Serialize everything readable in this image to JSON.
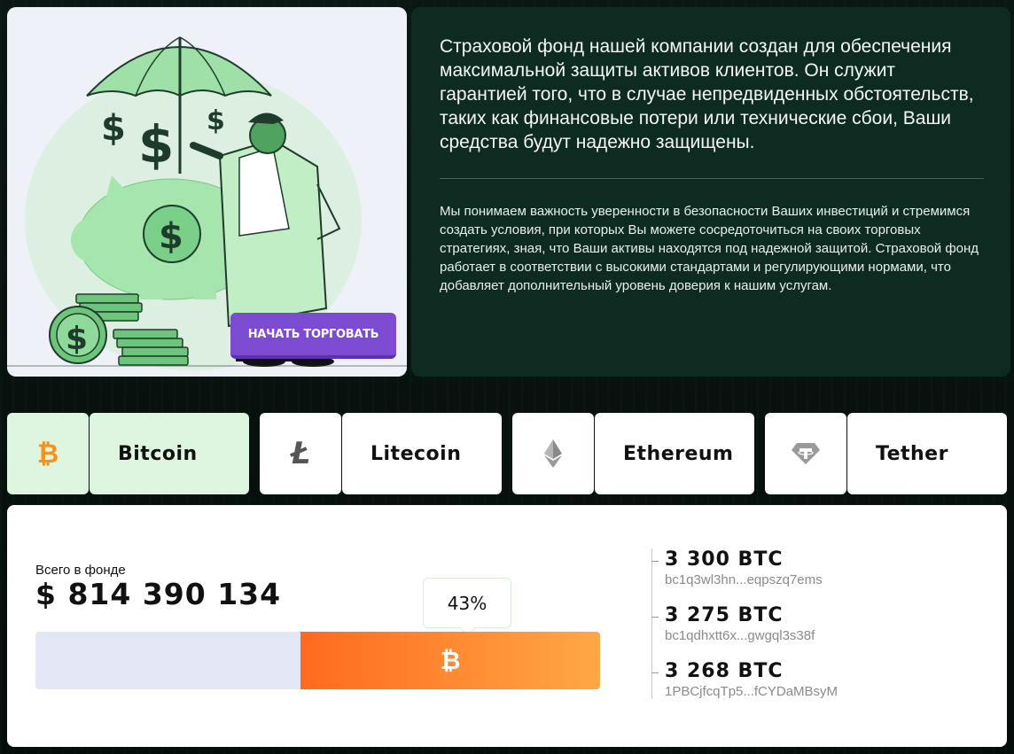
{
  "hero": {
    "start_button": "НАЧАТЬ ТОРГОВАТЬ"
  },
  "info": {
    "lead": "Страховой фонд нашей компании создан для обеспечения максимальной защиты активов клиентов. Он служит гарантией того, что в случае непредвиденных обстоятельств, таких как финансовые потери или технические сбои, Ваши средства будут надежно защищены.",
    "body": "Мы понимаем важность уверенности в безопасности Ваших инвестиций и стремимся создать условия, при которых Вы можете сосредоточиться на своих торговых стратегиях, зная, что Ваши активы находятся под надежной защитой. Страховой фонд работает в соответствии с высокими стандартами и регулирующими нормами, что добавляет дополнительный уровень доверия к нашим услугам."
  },
  "tabs": [
    {
      "label": "Bitcoin",
      "icon": "bitcoin-icon",
      "icon_glyph": "₿",
      "active": true,
      "color": "#f7931a"
    },
    {
      "label": "Litecoin",
      "icon": "litecoin-icon",
      "icon_glyph": "Ł",
      "active": false,
      "color": "#555555"
    },
    {
      "label": "Ethereum",
      "icon": "ethereum-icon",
      "icon_glyph": "◆",
      "active": false,
      "color": "#777777"
    },
    {
      "label": "Tether",
      "icon": "tether-icon",
      "icon_glyph": "₮",
      "active": false,
      "color": "#888888"
    }
  ],
  "fund": {
    "caption": "Всего в фонде",
    "total": "$ 814 390 134",
    "percent_label": "43%",
    "percent": 0.53,
    "bar_icon": "₿",
    "wallets": [
      {
        "amount": "3 300 BTC",
        "address": "bc1q3wl3hn...eqpszq7ems"
      },
      {
        "amount": "3 275 BTC",
        "address": "bc1qdhxtt6x...gwgql3s38f"
      },
      {
        "amount": "3 268 BTC",
        "address": "1PBCjfcqTp5...fCYDaMBsyM"
      }
    ]
  },
  "colors": {
    "accent_purple": "#7b4bd1",
    "accent_orange": "#ff6a1f",
    "dark_green": "#0e2b22",
    "light_green": "#def5df"
  }
}
